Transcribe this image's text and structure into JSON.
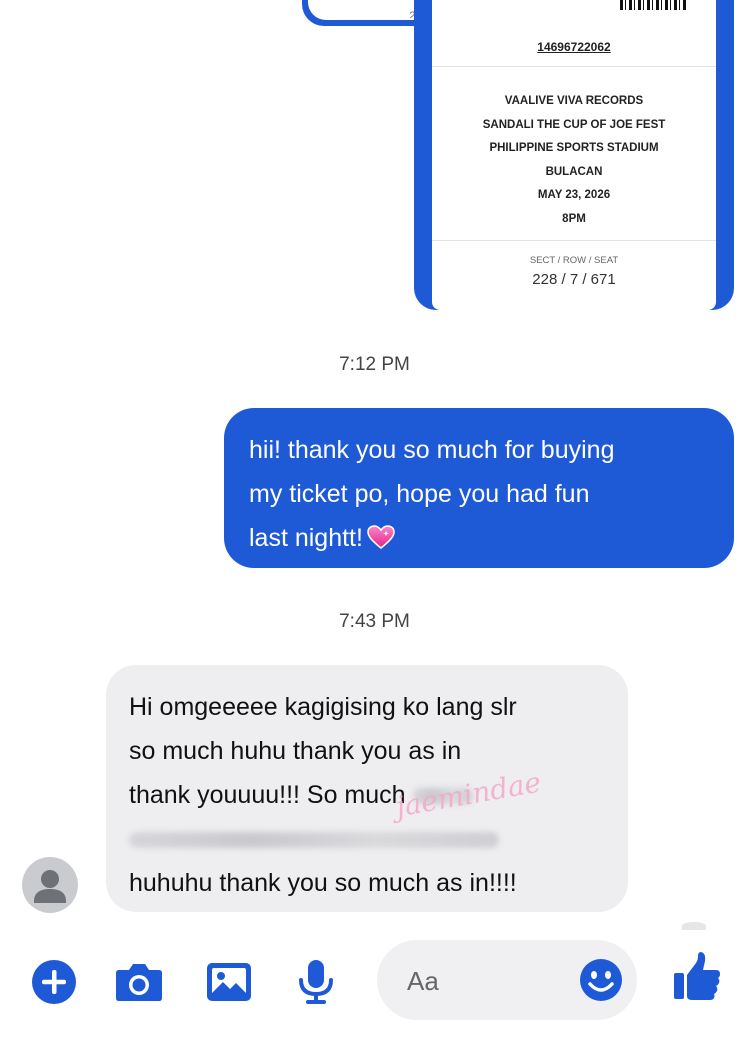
{
  "previous_image": {
    "partial_text": "228 / 7 / 671"
  },
  "ticket": {
    "id": "14696722062",
    "lines": [
      "VAALIVE VIVA RECORDS",
      "SANDALI THE CUP OF JOE FEST",
      "PHILIPPINE SPORTS STADIUM",
      "BULACAN",
      "MAY 23, 2026",
      "8PM"
    ],
    "seat_label": "SECT / ROW / SEAT",
    "seat_value": "228 / 7 / 671"
  },
  "messages": [
    {
      "timestamp": "7:12 PM",
      "direction": "sent",
      "lines": [
        "hii! thank you so much for buying",
        "my ticket po, hope you had fun",
        "last nightt!"
      ],
      "emoji": "heart-icon"
    },
    {
      "timestamp": "7:43 PM",
      "direction": "received",
      "lines": [
        "Hi omgeeeee kagigising ko lang slr",
        "so much huhu thank you as in",
        "thank youuuu!!! So much",
        "",
        "huhuhu thank you so much as in!!!!"
      ],
      "watermark": "jaemindae"
    }
  ],
  "composer": {
    "placeholder": "Aa",
    "icons": [
      "plus-icon",
      "camera-icon",
      "image-icon",
      "microphone-icon",
      "emoji-icon",
      "thumbs-up-icon"
    ]
  },
  "colors": {
    "accent": "#1f5ad6",
    "received_bubble": "#eeeef1"
  }
}
